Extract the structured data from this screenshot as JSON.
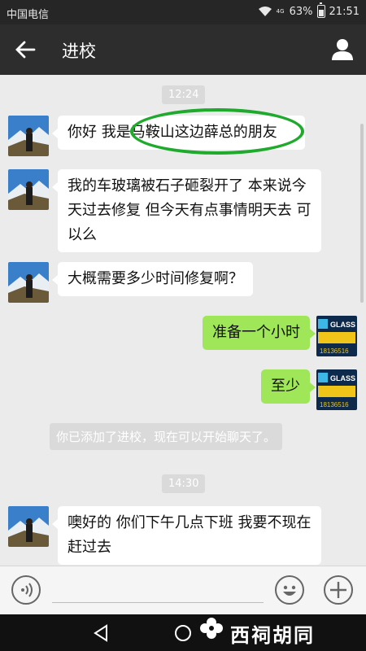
{
  "status_bar": {
    "carrier": "中国电信",
    "signal_label": "4G",
    "battery": "63%",
    "time": "21:51"
  },
  "header": {
    "title": "进校"
  },
  "chat": {
    "timestamps": [
      "12:24",
      "14:30"
    ],
    "messages": [
      {
        "side": "left",
        "text": "你好 我是马鞍山这边薛总的朋友"
      },
      {
        "side": "left",
        "text": "我的车玻璃被石子砸裂开了 本来说今天过去修复 但今天有点事情明天去 可以么"
      },
      {
        "side": "left",
        "text": "大概需要多少时间修复啊？"
      },
      {
        "side": "right",
        "text": "准备一个小时"
      },
      {
        "side": "right",
        "text": "至少"
      },
      {
        "side": "left",
        "text": "噢好的 你们下午几点下班 我要不现在赶过去"
      }
    ],
    "system_message": "你已添加了进校，现在可以开始聊天了。",
    "highlight_color": "#1faa2d"
  },
  "right_avatar": {
    "brand": "GLASS",
    "phone": "18136516"
  },
  "watermark": "西祠胡同",
  "icons": [
    "back-arrow-icon",
    "contact-icon",
    "voice-icon",
    "emoji-icon",
    "plus-icon",
    "nav-back-icon",
    "nav-home-icon"
  ]
}
